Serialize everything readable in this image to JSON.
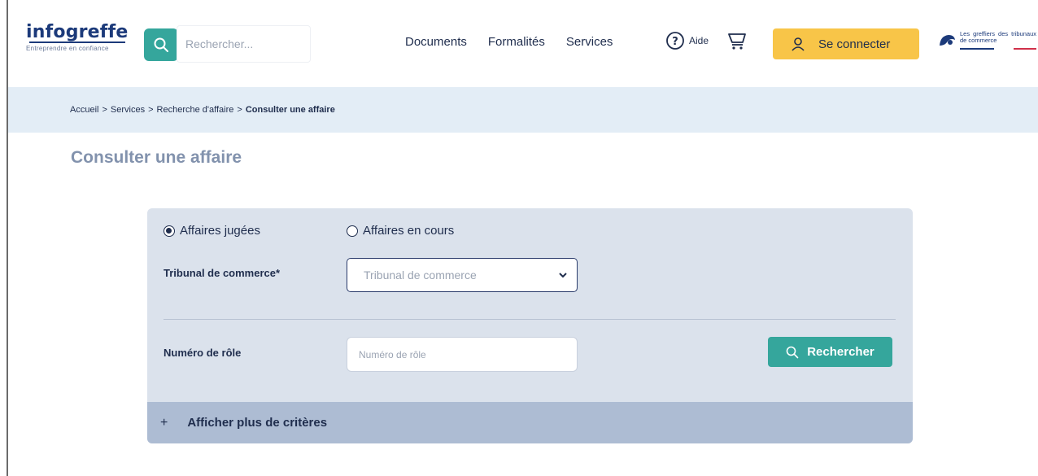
{
  "header": {
    "logo_title": "infogreffe",
    "logo_tagline": "Entreprendre en confiance",
    "search_placeholder": "Rechercher...",
    "nav": [
      "Documents",
      "Formalités",
      "Services"
    ],
    "aide_label": "Aide",
    "connect_label": "Se connecter",
    "partner_text": "Les greffiers des tribunaux de commerce"
  },
  "breadcrumb": {
    "items": [
      "Accueil",
      "Services",
      "Recherche d'affaire"
    ],
    "separator": ">",
    "current": "Consulter une affaire"
  },
  "page_title": "Consulter une affaire",
  "form": {
    "radio_options": [
      {
        "label": "Affaires jugées",
        "checked": true
      },
      {
        "label": "Affaires en cours",
        "checked": false
      }
    ],
    "tribunal_label": "Tribunal de commerce*",
    "tribunal_placeholder": "Tribunal de commerce",
    "numero_label": "Numéro de rôle",
    "numero_placeholder": "Numéro de rôle",
    "search_button": "Rechercher",
    "more_criteria": "Afficher plus de critères",
    "more_symbol": "+"
  },
  "colors": {
    "brand_navy": "#1c3a7a",
    "teal": "#35a69c",
    "yellow": "#f8c548",
    "breadcrumb_bg": "#e3edf6",
    "card_bg": "#dbe2ec",
    "more_bg": "#adbcd3"
  }
}
